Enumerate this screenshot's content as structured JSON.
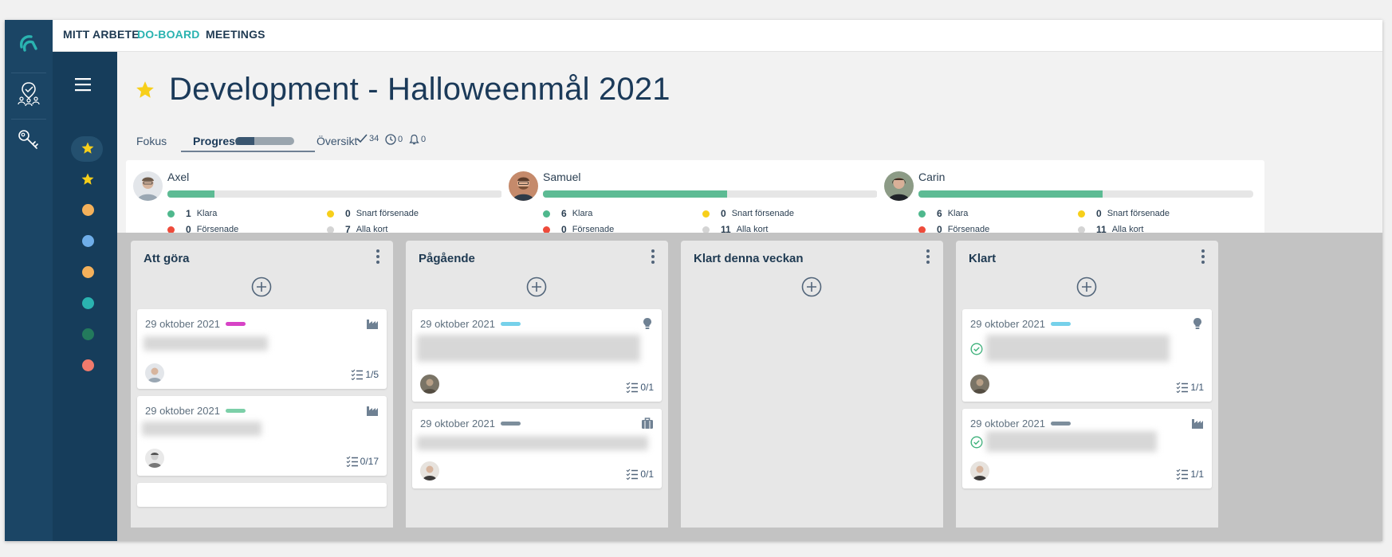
{
  "nav": {
    "items": [
      {
        "label": "MITT ARBETE",
        "active": false
      },
      {
        "label": "DO-BOARD",
        "active": true
      },
      {
        "label": "MEETINGS",
        "active": false
      }
    ]
  },
  "sidebar": {
    "dots": [
      "#f4b15b",
      "#6faee9",
      "#f4b15b",
      "#2ab3b0",
      "#237a5c",
      "#f07a6c"
    ]
  },
  "header": {
    "title": "Development - Halloweenmål 2021",
    "tabs": {
      "fokus": "Fokus",
      "progress": "Progress",
      "oversikt": "Översikt"
    },
    "progress_fraction": 0.32,
    "stats": {
      "done": "34",
      "time": "0",
      "alerts": "0"
    }
  },
  "people": [
    {
      "name": "Axel",
      "progress": 0.14,
      "klara": "1",
      "forsenade": "0",
      "snart": "0",
      "alla": "7"
    },
    {
      "name": "Samuel",
      "progress": 0.55,
      "klara": "6",
      "forsenade": "0",
      "snart": "0",
      "alla": "11"
    },
    {
      "name": "Carin",
      "progress": 0.55,
      "klara": "6",
      "forsenade": "0",
      "snart": "0",
      "alla": "11"
    }
  ],
  "labels": {
    "klara": "Klara",
    "forsenade": "Försenade",
    "snart": "Snart försenade",
    "alla": "Alla kort"
  },
  "colors": {
    "green": "#4fb88d",
    "red": "#ee4b3b",
    "yellow": "#f7cf1a",
    "grey": "#d4d4d4",
    "accent": "#2ab3b0"
  },
  "columns": [
    {
      "title": "Att göra",
      "cards": [
        {
          "date": "29 oktober 2021",
          "tag": "#d743c6",
          "type": "factory-icon",
          "check": "1/5"
        },
        {
          "date": "29 oktober 2021",
          "tag": "#7ccfa8",
          "type": "factory-icon",
          "check": "0/17"
        }
      ]
    },
    {
      "title": "Pågående",
      "cards": [
        {
          "date": "29 oktober 2021",
          "tag": "#76d1ea",
          "type": "lightbulb-icon",
          "check": "0/1"
        },
        {
          "date": "29 oktober 2021",
          "tag": "#7d8e9c",
          "type": "briefcase-icon",
          "check": "0/1"
        }
      ]
    },
    {
      "title": "Klart denna veckan",
      "cards": []
    },
    {
      "title": "Klart",
      "cards": [
        {
          "date": "29 oktober 2021",
          "tag": "#76d1ea",
          "type": "lightbulb-icon",
          "check": "1/1"
        },
        {
          "date": "29 oktober 2021",
          "tag": "#7d8e9c",
          "type": "factory-icon",
          "check": "1/1"
        }
      ]
    }
  ]
}
